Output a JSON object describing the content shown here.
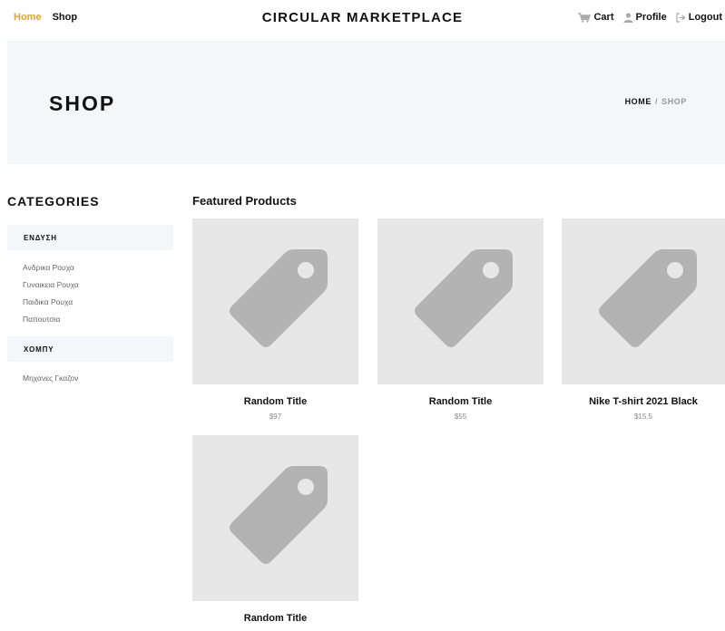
{
  "nav": {
    "home": "Home",
    "shop": "Shop",
    "brand": "CIRCULAR MARKETPLACE",
    "cart": "Cart",
    "profile": "Profile",
    "logout": "Logout",
    "cart_icon": "cart-icon",
    "profile_icon": "user-icon",
    "logout_icon": "logout-icon"
  },
  "hero": {
    "title": "SHOP",
    "breadcrumb": {
      "home": "HOME",
      "separator": "/",
      "current": "SHOP"
    }
  },
  "sidebar": {
    "heading": "CATEGORIES",
    "groups": [
      {
        "name": "ΕΝΔΥΣΗ",
        "items": [
          "Ανδρικα Ρουχα",
          "Γυναικεια Ρουχα",
          "Παιδικα Ρουχα",
          "Παπουτσια"
        ]
      },
      {
        "name": "ΧΟΜΠΥ",
        "items": [
          "Μηχανες Γκαζον"
        ]
      }
    ]
  },
  "main": {
    "heading": "Featured Products",
    "products": [
      {
        "title": "Random Title",
        "price": "$97",
        "image_icon": "price-tag-icon"
      },
      {
        "title": "Random Title",
        "price": "$55",
        "image_icon": "price-tag-icon"
      },
      {
        "title": "Nike T-shirt 2021 Black",
        "price": "$15.5",
        "image_icon": "price-tag-icon"
      },
      {
        "title": "Random Title",
        "price": "",
        "image_icon": "price-tag-icon"
      }
    ]
  },
  "colors": {
    "accent": "#e0a33a",
    "hero_bg": "#f4f7fa",
    "placeholder_bg": "#e7e7e7",
    "placeholder_icon": "#b3b3b3"
  }
}
